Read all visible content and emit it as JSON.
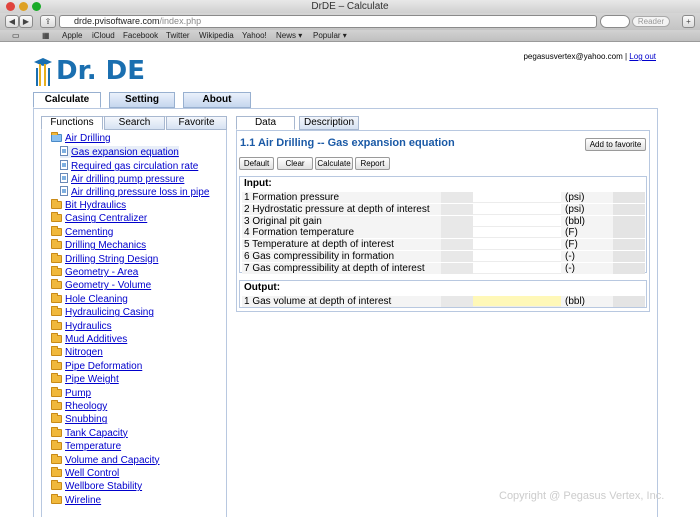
{
  "browser": {
    "window_title": "DrDE – Calculate",
    "url_host": "drde.pvisoftware.com",
    "url_path": "/index.php",
    "reader_label": "Reader",
    "bookmarks": [
      "Apple",
      "iCloud",
      "Facebook",
      "Twitter",
      "Wikipedia",
      "Yahoo!",
      "News ▾",
      "Popular ▾"
    ]
  },
  "header": {
    "logo_text": "Dr. DE",
    "user_email": "pegasusvertex@yahoo.com",
    "separator": " | ",
    "logout_label": "Log out"
  },
  "main_tabs": [
    "Calculate",
    "Setting",
    "About"
  ],
  "left_tabs": [
    "Functions",
    "Search",
    "Favorite"
  ],
  "tree": {
    "open_folder": "Air Drilling",
    "children": [
      "Gas expansion equation",
      "Required gas circulation rate",
      "Air drilling pump pressure",
      "Air drilling pressure loss in pipe"
    ],
    "folders": [
      "Bit Hydraulics",
      "Casing Centralizer",
      "Cementing",
      "Drilling Mechanics",
      "Drilling String Design",
      "Geometry - Area",
      "Geometry - Volume",
      "Hole Cleaning",
      "Hydraulicing Casing",
      "Hydraulics",
      "Mud Additives",
      "Nitrogen",
      "Pipe Deformation",
      "Pipe Weight",
      "Pump",
      "Rheology",
      "Snubbing",
      "Tank Capacity",
      "Temperature",
      "Volume and Capacity",
      "Well Control",
      "Wellbore Stability",
      "Wireline"
    ]
  },
  "right_tabs": [
    "Data",
    "Description"
  ],
  "calc": {
    "title": "1.1  Air Drilling -- Gas expansion equation",
    "favorite_label": "Add to favorite",
    "buttons": [
      "Default",
      "Clear",
      "Calculate",
      "Report"
    ],
    "input_title": "Input:",
    "inputs": [
      {
        "label": "1  Formation pressure",
        "value": "",
        "unit": "(psi)"
      },
      {
        "label": "2  Hydrostatic pressure at depth of interest",
        "value": "",
        "unit": "(psi)"
      },
      {
        "label": "3  Original pit gain",
        "value": "",
        "unit": "(bbl)"
      },
      {
        "label": "4  Formation temperature",
        "value": "",
        "unit": "(F)"
      },
      {
        "label": "5  Temperature at depth of interest",
        "value": "",
        "unit": "(F)"
      },
      {
        "label": "6  Gas compressibility in formation",
        "value": "",
        "unit": "(-)"
      },
      {
        "label": "7  Gas compressibility at depth of interest",
        "value": "",
        "unit": "(-)"
      }
    ],
    "output_title": "Output:",
    "outputs": [
      {
        "label": "1  Gas volume at depth of interest",
        "value": "",
        "unit": "(bbl)"
      }
    ]
  },
  "footer": {
    "copyright": "Copyright @ Pegasus Vertex, Inc."
  }
}
